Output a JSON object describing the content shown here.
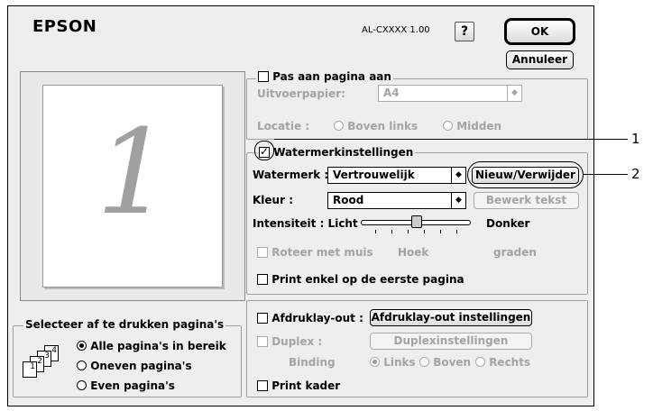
{
  "header": {
    "brand": "EPSON",
    "version": "AL-CXXXX 1.00",
    "help_label": "?",
    "ok_label": "OK",
    "cancel_label": "Annuleer"
  },
  "preview": {
    "page_number": "1"
  },
  "fit_to_page": {
    "label": "Pas aan pagina aan",
    "output_paper_label": "Uitvoerpapier:",
    "output_paper_value": "A4",
    "location_label": "Locatie :",
    "location_options": [
      "Boven links",
      "Midden"
    ]
  },
  "watermark": {
    "label": "Watermerkinstellingen",
    "watermark_label": "Watermerk :",
    "watermark_value": "Vertrouwelijk",
    "new_delete_label": "Nieuw/Verwijder",
    "color_label": "Kleur :",
    "color_value": "Rood",
    "edit_text_label": "Bewerk tekst",
    "intensity_label": "Intensiteit : Licht",
    "intensity_dark": "Donker",
    "intensity_level": 0.5,
    "rotate_label": "Roteer met muis",
    "angle_label": "Hoek",
    "degrees_label": "graden",
    "first_page_label": "Print enkel op de eerste pagina"
  },
  "layout": {
    "print_layout_label": "Afdruklay-out :",
    "print_layout_button": "Afdruklay-out instellingen",
    "duplex_label": "Duplex :",
    "duplex_button": "Duplexinstellingen",
    "binding_label": "Binding",
    "binding_options": [
      "Links",
      "Boven",
      "Rechts"
    ],
    "frame_label": "Print kader"
  },
  "page_select": {
    "title": "Selecteer af te drukken pagina's",
    "options": [
      "Alle pagina's in bereik",
      "Oneven pagina's",
      "Even pagina's"
    ],
    "icon_numbers": [
      "1",
      "2",
      "3",
      "4"
    ]
  },
  "callouts": [
    "1",
    "2"
  ]
}
